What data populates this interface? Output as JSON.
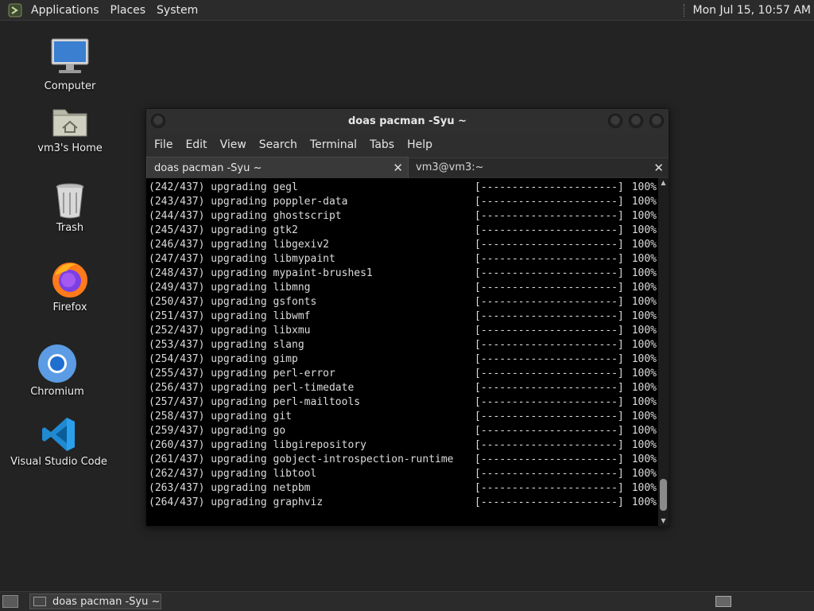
{
  "top_panel": {
    "menus": [
      "Applications",
      "Places",
      "System"
    ],
    "clock": "Mon Jul 15, 10:57 AM"
  },
  "desktop_icons": [
    {
      "label": "Computer",
      "icon": "computer-icon"
    },
    {
      "label": "vm3's Home",
      "icon": "home-folder-icon"
    },
    {
      "label": "Trash",
      "icon": "trash-icon"
    },
    {
      "label": "Firefox",
      "icon": "firefox-icon"
    },
    {
      "label": "Chromium",
      "icon": "chromium-icon"
    },
    {
      "label": "Visual Studio Code",
      "icon": "vscode-icon"
    }
  ],
  "window": {
    "title": "doas pacman -Syu ~",
    "menu": [
      "File",
      "Edit",
      "View",
      "Search",
      "Terminal",
      "Tabs",
      "Help"
    ],
    "tabs": [
      {
        "label": "doas pacman -Syu ~",
        "active": true
      },
      {
        "label": "vm3@vm3:~",
        "active": false
      }
    ],
    "close_glyph": "✕"
  },
  "terminal": {
    "progress_bar": "[----------------------]",
    "lines": [
      {
        "text": "(242/437) upgrading gegl",
        "percent": "100%"
      },
      {
        "text": "(243/437) upgrading poppler-data",
        "percent": "100%"
      },
      {
        "text": "(244/437) upgrading ghostscript",
        "percent": "100%"
      },
      {
        "text": "(245/437) upgrading gtk2",
        "percent": "100%"
      },
      {
        "text": "(246/437) upgrading libgexiv2",
        "percent": "100%"
      },
      {
        "text": "(247/437) upgrading libmypaint",
        "percent": "100%"
      },
      {
        "text": "(248/437) upgrading mypaint-brushes1",
        "percent": "100%"
      },
      {
        "text": "(249/437) upgrading libmng",
        "percent": "100%"
      },
      {
        "text": "(250/437) upgrading gsfonts",
        "percent": "100%"
      },
      {
        "text": "(251/437) upgrading libwmf",
        "percent": "100%"
      },
      {
        "text": "(252/437) upgrading libxmu",
        "percent": "100%"
      },
      {
        "text": "(253/437) upgrading slang",
        "percent": "100%"
      },
      {
        "text": "(254/437) upgrading gimp",
        "percent": "100%"
      },
      {
        "text": "(255/437) upgrading perl-error",
        "percent": "100%"
      },
      {
        "text": "(256/437) upgrading perl-timedate",
        "percent": "100%"
      },
      {
        "text": "(257/437) upgrading perl-mailtools",
        "percent": "100%"
      },
      {
        "text": "(258/437) upgrading git",
        "percent": "100%"
      },
      {
        "text": "(259/437) upgrading go",
        "percent": "100%"
      },
      {
        "text": "(260/437) upgrading libgirepository",
        "percent": "100%"
      },
      {
        "text": "(261/437) upgrading gobject-introspection-runtime",
        "percent": "100%"
      },
      {
        "text": "(262/437) upgrading libtool",
        "percent": "100%"
      },
      {
        "text": "(263/437) upgrading netpbm",
        "percent": "100%"
      },
      {
        "text": "(264/437) upgrading graphviz",
        "percent": "100%"
      }
    ]
  },
  "taskbar": {
    "tasks": [
      {
        "label": "doas pacman -Syu ~",
        "icon": "terminal-icon"
      }
    ]
  },
  "colors": {
    "desktop_bg": "#232323",
    "panel_bg": "#2b2b2b",
    "terminal_bg": "#000000",
    "terminal_fg": "#dcdcdc"
  }
}
